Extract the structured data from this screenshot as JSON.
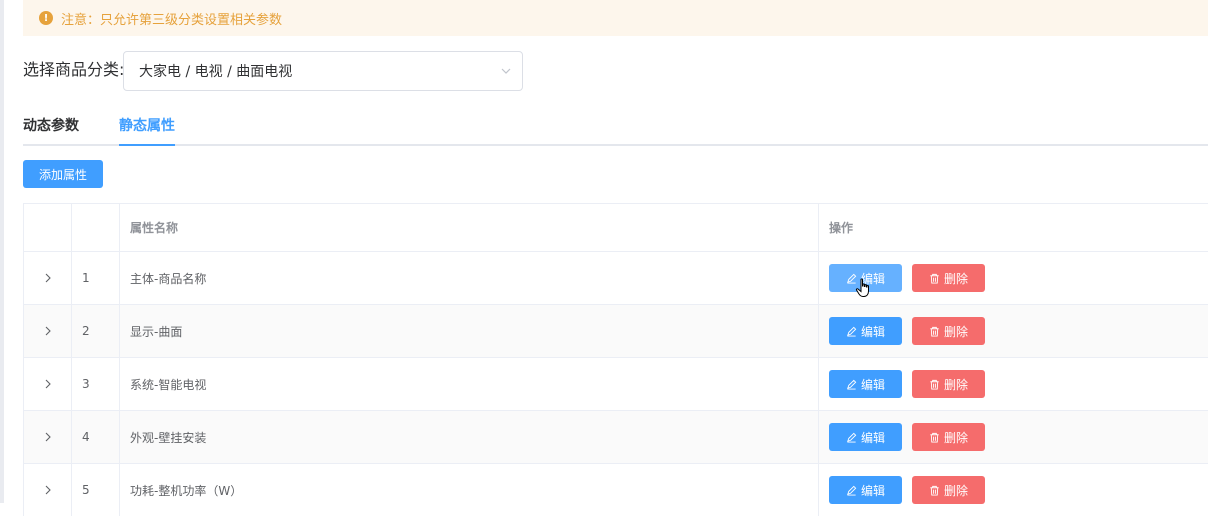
{
  "alert": {
    "icon": "warning-icon",
    "text": "注意：只允许第三级分类设置相关参数",
    "color": "#e6a23c"
  },
  "category": {
    "label": "选择商品分类:",
    "value": "大家电 / 电视 / 曲面电视"
  },
  "tabs": [
    {
      "label": "动态参数",
      "active": false
    },
    {
      "label": "静态属性",
      "active": true
    }
  ],
  "add_button": "添加属性",
  "table": {
    "headers": [
      "",
      "",
      "属性名称",
      "操作"
    ],
    "rows": [
      {
        "index": "1",
        "name": "主体-商品名称"
      },
      {
        "index": "2",
        "name": "显示-曲面"
      },
      {
        "index": "3",
        "name": "系统-智能电视"
      },
      {
        "index": "4",
        "name": "外观-壁挂安装"
      },
      {
        "index": "5",
        "name": "功耗-整机功率（W）"
      }
    ],
    "edit_label": "编辑",
    "delete_label": "删除"
  },
  "colors": {
    "primary": "#409eff",
    "danger": "#f56c6c",
    "warning": "#e6a23c"
  }
}
